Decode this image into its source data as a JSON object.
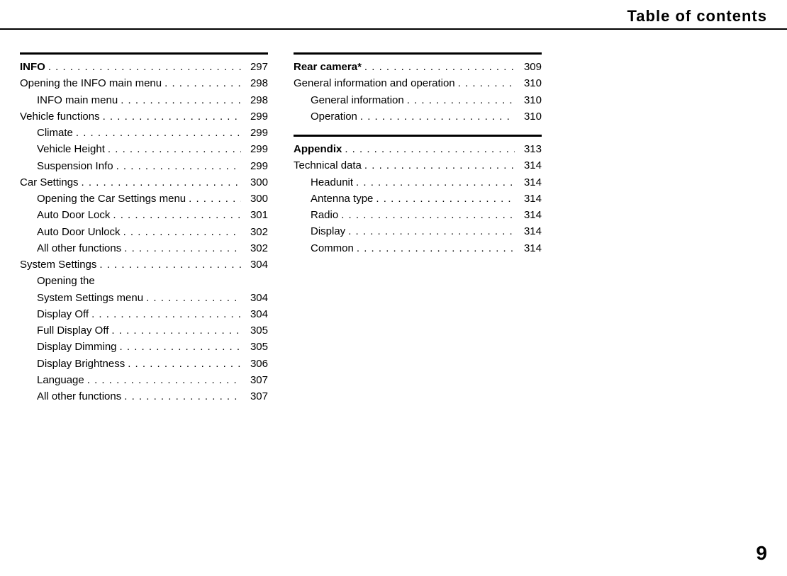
{
  "header": {
    "title": "Table of contents"
  },
  "page_number": "9",
  "col1": {
    "sections": [
      {
        "rule": true,
        "rows": [
          {
            "label": "INFO",
            "page": "297",
            "bold": true
          },
          {
            "label": "Opening the INFO main menu",
            "page": "298"
          },
          {
            "label": "INFO main menu",
            "page": "298",
            "sub": true
          },
          {
            "label": "Vehicle functions",
            "page": "299"
          },
          {
            "label": "Climate",
            "page": "299",
            "sub": true
          },
          {
            "label": "Vehicle Height",
            "page": "299",
            "sub": true
          },
          {
            "label": "Suspension Info",
            "page": "299",
            "sub": true
          },
          {
            "label": "Car Settings",
            "page": "300"
          },
          {
            "label": "Opening the Car Settings menu",
            "page": "300",
            "sub": true
          },
          {
            "label": "Auto Door Lock",
            "page": "301",
            "sub": true
          },
          {
            "label": "Auto Door Unlock",
            "page": "302",
            "sub": true
          },
          {
            "label": "All other functions",
            "page": "302",
            "sub": true
          },
          {
            "label": "System Settings",
            "page": "304"
          },
          {
            "label": "Opening the",
            "cont": true,
            "sub": true
          },
          {
            "label": "System Settings menu",
            "page": "304",
            "sub": true
          },
          {
            "label": "Display Off",
            "page": "304",
            "sub": true
          },
          {
            "label": "Full Display Off",
            "page": "305",
            "sub": true
          },
          {
            "label": "Display Dimming",
            "page": "305",
            "sub": true
          },
          {
            "label": "Display Brightness",
            "page": "306",
            "sub": true
          },
          {
            "label": "Language",
            "page": "307",
            "sub": true
          },
          {
            "label": "All other functions",
            "page": "307",
            "sub": true
          }
        ]
      }
    ]
  },
  "col2": {
    "sections": [
      {
        "rule": true,
        "rows": [
          {
            "label": "Rear camera*",
            "page": "309",
            "bold": true
          },
          {
            "label": "General information and operation",
            "page": "310"
          },
          {
            "label": "General information",
            "page": "310",
            "sub": true
          },
          {
            "label": "Operation",
            "page": "310",
            "sub": true
          }
        ]
      },
      {
        "rule": true,
        "rows": [
          {
            "label": "Appendix",
            "page": "313",
            "bold": true
          },
          {
            "label": "Technical data",
            "page": "314"
          },
          {
            "label": "Headunit",
            "page": "314",
            "sub": true
          },
          {
            "label": "Antenna type",
            "page": "314",
            "sub": true
          },
          {
            "label": "Radio",
            "page": "314",
            "sub": true
          },
          {
            "label": "Display",
            "page": "314",
            "sub": true
          },
          {
            "label": "Common",
            "page": "314",
            "sub": true
          }
        ]
      }
    ]
  }
}
